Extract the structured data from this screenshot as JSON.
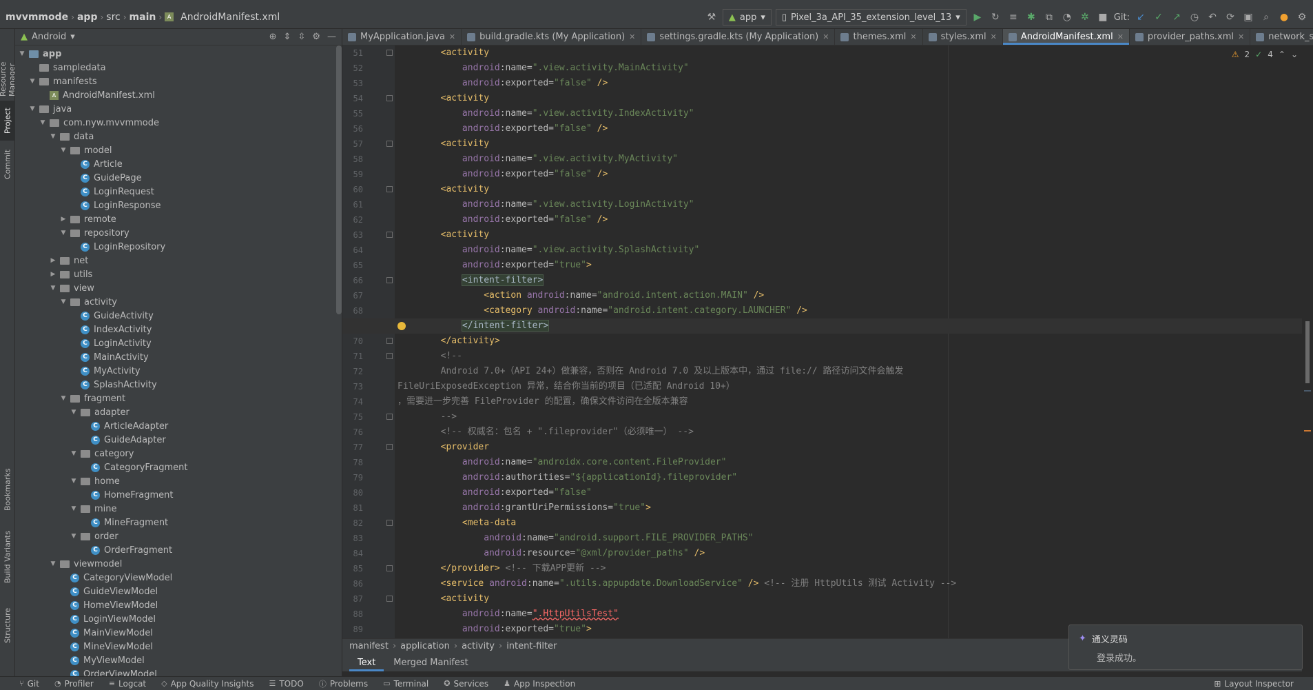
{
  "navbar": {
    "project": "mvvmmode",
    "module": "app",
    "src": "src",
    "main": "main",
    "file": "AndroidManifest.xml",
    "run_config": "app",
    "device": "Pixel_3a_API_35_extension_level_13",
    "git_label": "Git:"
  },
  "left_tools": [
    "Resource Manager",
    "Project",
    "Commit",
    "Bookmarks",
    "Build Variants",
    "Structure"
  ],
  "project_panel": {
    "view": "Android",
    "tree": [
      {
        "label": "app",
        "kind": "module",
        "depth": 0,
        "open": true,
        "bold": true
      },
      {
        "label": "sampledata",
        "kind": "folder",
        "depth": 1,
        "open": null
      },
      {
        "label": "manifests",
        "kind": "folder",
        "depth": 1,
        "open": true
      },
      {
        "label": "AndroidManifest.xml",
        "kind": "xml",
        "depth": 2,
        "open": null
      },
      {
        "label": "java",
        "kind": "folder",
        "depth": 1,
        "open": true
      },
      {
        "label": "com.nyw.mvvmmode",
        "kind": "folder",
        "depth": 2,
        "open": true
      },
      {
        "label": "data",
        "kind": "folder",
        "depth": 3,
        "open": true
      },
      {
        "label": "model",
        "kind": "folder",
        "depth": 4,
        "open": true
      },
      {
        "label": "Article",
        "kind": "class",
        "depth": 5,
        "open": null
      },
      {
        "label": "GuidePage",
        "kind": "class",
        "depth": 5,
        "open": null
      },
      {
        "label": "LoginRequest",
        "kind": "class",
        "depth": 5,
        "open": null
      },
      {
        "label": "LoginResponse",
        "kind": "class",
        "depth": 5,
        "open": null
      },
      {
        "label": "remote",
        "kind": "folder",
        "depth": 4,
        "open": false
      },
      {
        "label": "repository",
        "kind": "folder",
        "depth": 4,
        "open": true
      },
      {
        "label": "LoginRepository",
        "kind": "class",
        "depth": 5,
        "open": null
      },
      {
        "label": "net",
        "kind": "folder",
        "depth": 3,
        "open": false
      },
      {
        "label": "utils",
        "kind": "folder",
        "depth": 3,
        "open": false
      },
      {
        "label": "view",
        "kind": "folder",
        "depth": 3,
        "open": true
      },
      {
        "label": "activity",
        "kind": "folder",
        "depth": 4,
        "open": true
      },
      {
        "label": "GuideActivity",
        "kind": "class",
        "depth": 5,
        "open": null
      },
      {
        "label": "IndexActivity",
        "kind": "class",
        "depth": 5,
        "open": null
      },
      {
        "label": "LoginActivity",
        "kind": "class",
        "depth": 5,
        "open": null
      },
      {
        "label": "MainActivity",
        "kind": "class",
        "depth": 5,
        "open": null
      },
      {
        "label": "MyActivity",
        "kind": "class",
        "depth": 5,
        "open": null
      },
      {
        "label": "SplashActivity",
        "kind": "class",
        "depth": 5,
        "open": null
      },
      {
        "label": "fragment",
        "kind": "folder",
        "depth": 4,
        "open": true
      },
      {
        "label": "adapter",
        "kind": "folder",
        "depth": 5,
        "open": true
      },
      {
        "label": "ArticleAdapter",
        "kind": "class",
        "depth": 6,
        "open": null
      },
      {
        "label": "GuideAdapter",
        "kind": "class",
        "depth": 6,
        "open": null
      },
      {
        "label": "category",
        "kind": "folder",
        "depth": 5,
        "open": true
      },
      {
        "label": "CategoryFragment",
        "kind": "class",
        "depth": 6,
        "open": null
      },
      {
        "label": "home",
        "kind": "folder",
        "depth": 5,
        "open": true
      },
      {
        "label": "HomeFragment",
        "kind": "class",
        "depth": 6,
        "open": null
      },
      {
        "label": "mine",
        "kind": "folder",
        "depth": 5,
        "open": true
      },
      {
        "label": "MineFragment",
        "kind": "class",
        "depth": 6,
        "open": null
      },
      {
        "label": "order",
        "kind": "folder",
        "depth": 5,
        "open": true
      },
      {
        "label": "OrderFragment",
        "kind": "class",
        "depth": 6,
        "open": null
      },
      {
        "label": "viewmodel",
        "kind": "folder",
        "depth": 3,
        "open": true
      },
      {
        "label": "CategoryViewModel",
        "kind": "class",
        "depth": 4,
        "open": null
      },
      {
        "label": "GuideViewModel",
        "kind": "class",
        "depth": 4,
        "open": null
      },
      {
        "label": "HomeViewModel",
        "kind": "class",
        "depth": 4,
        "open": null
      },
      {
        "label": "LoginViewModel",
        "kind": "class",
        "depth": 4,
        "open": null
      },
      {
        "label": "MainViewModel",
        "kind": "class",
        "depth": 4,
        "open": null
      },
      {
        "label": "MineViewModel",
        "kind": "class",
        "depth": 4,
        "open": null
      },
      {
        "label": "MyViewModel",
        "kind": "class",
        "depth": 4,
        "open": null
      },
      {
        "label": "OrderViewModel",
        "kind": "class",
        "depth": 4,
        "open": null
      }
    ]
  },
  "tabs": [
    {
      "label": "MyApplication.java",
      "active": false
    },
    {
      "label": "build.gradle.kts (My Application)",
      "active": false
    },
    {
      "label": "settings.gradle.kts (My Application)",
      "active": false
    },
    {
      "label": "themes.xml",
      "active": false
    },
    {
      "label": "styles.xml",
      "active": false
    },
    {
      "label": "AndroidManifest.xml",
      "active": true
    },
    {
      "label": "provider_paths.xml",
      "active": false
    },
    {
      "label": "network_security_c",
      "active": false
    }
  ],
  "inspections": {
    "warnings": "2",
    "ok": "4"
  },
  "editor": {
    "current_line": 69,
    "lines": [
      {
        "n": 51,
        "indent": 2,
        "parts": [
          [
            "t",
            "<activity"
          ]
        ]
      },
      {
        "n": 52,
        "indent": 3,
        "parts": [
          [
            "a",
            "android"
          ],
          [
            "an",
            ":name="
          ],
          [
            "s",
            "\".view.activity.MainActivity\""
          ]
        ]
      },
      {
        "n": 53,
        "indent": 3,
        "parts": [
          [
            "a",
            "android"
          ],
          [
            "an",
            ":exported="
          ],
          [
            "s",
            "\"false\""
          ],
          [
            "t",
            " />"
          ]
        ]
      },
      {
        "n": 54,
        "indent": 2,
        "parts": [
          [
            "t",
            "<activity"
          ]
        ]
      },
      {
        "n": 55,
        "indent": 3,
        "parts": [
          [
            "a",
            "android"
          ],
          [
            "an",
            ":name="
          ],
          [
            "s",
            "\".view.activity.IndexActivity\""
          ]
        ]
      },
      {
        "n": 56,
        "indent": 3,
        "parts": [
          [
            "a",
            "android"
          ],
          [
            "an",
            ":exported="
          ],
          [
            "s",
            "\"false\""
          ],
          [
            "t",
            " />"
          ]
        ]
      },
      {
        "n": 57,
        "indent": 2,
        "parts": [
          [
            "t",
            "<activity"
          ]
        ]
      },
      {
        "n": 58,
        "indent": 3,
        "parts": [
          [
            "a",
            "android"
          ],
          [
            "an",
            ":name="
          ],
          [
            "s",
            "\".view.activity.MyActivity\""
          ]
        ]
      },
      {
        "n": 59,
        "indent": 3,
        "parts": [
          [
            "a",
            "android"
          ],
          [
            "an",
            ":exported="
          ],
          [
            "s",
            "\"false\""
          ],
          [
            "t",
            " />"
          ]
        ]
      },
      {
        "n": 60,
        "indent": 2,
        "parts": [
          [
            "t",
            "<activity"
          ]
        ]
      },
      {
        "n": 61,
        "indent": 3,
        "parts": [
          [
            "a",
            "android"
          ],
          [
            "an",
            ":name="
          ],
          [
            "s",
            "\".view.activity.LoginActivity\""
          ]
        ]
      },
      {
        "n": 62,
        "indent": 3,
        "parts": [
          [
            "a",
            "android"
          ],
          [
            "an",
            ":exported="
          ],
          [
            "s",
            "\"false\""
          ],
          [
            "t",
            " />"
          ]
        ]
      },
      {
        "n": 63,
        "indent": 2,
        "parts": [
          [
            "t",
            "<activity"
          ]
        ]
      },
      {
        "n": 64,
        "indent": 3,
        "parts": [
          [
            "a",
            "android"
          ],
          [
            "an",
            ":name="
          ],
          [
            "s",
            "\".view.activity.SplashActivity\""
          ]
        ]
      },
      {
        "n": 65,
        "indent": 3,
        "parts": [
          [
            "a",
            "android"
          ],
          [
            "an",
            ":exported="
          ],
          [
            "s",
            "\"true\""
          ],
          [
            "t",
            ">"
          ]
        ]
      },
      {
        "n": 66,
        "indent": 3,
        "parts": [
          [
            "hl",
            "<intent-filter>"
          ]
        ]
      },
      {
        "n": 67,
        "indent": 4,
        "parts": [
          [
            "t",
            "<action "
          ],
          [
            "a",
            "android"
          ],
          [
            "an",
            ":name="
          ],
          [
            "s",
            "\"android.intent.action.MAIN\""
          ],
          [
            "t",
            " />"
          ]
        ]
      },
      {
        "n": 68,
        "indent": 4,
        "parts": [
          [
            "t",
            "<category "
          ],
          [
            "a",
            "android"
          ],
          [
            "an",
            ":name="
          ],
          [
            "s",
            "\"android.intent.category.LAUNCHER\""
          ],
          [
            "t",
            " />"
          ]
        ]
      },
      {
        "n": 69,
        "indent": 3,
        "parts": [
          [
            "hl",
            "</intent-filter>"
          ]
        ]
      },
      {
        "n": 70,
        "indent": 2,
        "parts": [
          [
            "t",
            "</activity>"
          ]
        ]
      },
      {
        "n": 71,
        "indent": 2,
        "parts": [
          [
            "cm",
            "<!--"
          ]
        ]
      },
      {
        "n": 72,
        "indent": 2,
        "parts": [
          [
            "cm",
            "Android 7.0+（API 24+）做兼容，否则在 Android 7.0 及以上版本中，通过 file:// 路径访问文件会触发"
          ]
        ]
      },
      {
        "n": 73,
        "indent": 0,
        "parts": [
          [
            "cm",
            "FileUriExposedException 异常，结合你当前的项目（已适配 Android 10+）"
          ]
        ]
      },
      {
        "n": 74,
        "indent": 0,
        "parts": [
          [
            "cm",
            "，需要进一步完善 FileProvider 的配置，确保文件访问在全版本兼容"
          ]
        ]
      },
      {
        "n": 75,
        "indent": 2,
        "parts": [
          [
            "cm",
            "-->"
          ]
        ]
      },
      {
        "n": 76,
        "indent": 2,
        "parts": [
          [
            "cm",
            "<!-- 权威名：包名 + \".fileprovider\"（必须唯一） -->"
          ]
        ]
      },
      {
        "n": 77,
        "indent": 2,
        "parts": [
          [
            "t",
            "<provider"
          ]
        ]
      },
      {
        "n": 78,
        "indent": 3,
        "parts": [
          [
            "a",
            "android"
          ],
          [
            "an",
            ":name="
          ],
          [
            "s",
            "\"androidx.core.content.FileProvider\""
          ]
        ]
      },
      {
        "n": 79,
        "indent": 3,
        "parts": [
          [
            "a",
            "android"
          ],
          [
            "an",
            ":authorities="
          ],
          [
            "s",
            "\"${applicationId}.fileprovider\""
          ]
        ]
      },
      {
        "n": 80,
        "indent": 3,
        "parts": [
          [
            "a",
            "android"
          ],
          [
            "an",
            ":exported="
          ],
          [
            "s",
            "\"false\""
          ]
        ]
      },
      {
        "n": 81,
        "indent": 3,
        "parts": [
          [
            "a",
            "android"
          ],
          [
            "an",
            ":grantUriPermissions="
          ],
          [
            "s",
            "\"true\""
          ],
          [
            "t",
            ">"
          ]
        ]
      },
      {
        "n": 82,
        "indent": 3,
        "parts": [
          [
            "t",
            "<meta-data"
          ]
        ]
      },
      {
        "n": 83,
        "indent": 4,
        "parts": [
          [
            "a",
            "android"
          ],
          [
            "an",
            ":name="
          ],
          [
            "s",
            "\"android.support.FILE_PROVIDER_PATHS\""
          ]
        ]
      },
      {
        "n": 84,
        "indent": 4,
        "parts": [
          [
            "a",
            "android"
          ],
          [
            "an",
            ":resource="
          ],
          [
            "s",
            "\"@xml/provider_paths\""
          ],
          [
            "t",
            " />"
          ]
        ]
      },
      {
        "n": 85,
        "indent": 2,
        "parts": [
          [
            "t",
            "</provider>"
          ],
          [
            "cm",
            " <!-- 下载APP更新 -->"
          ]
        ]
      },
      {
        "n": 86,
        "indent": 2,
        "parts": [
          [
            "t",
            "<service "
          ],
          [
            "a",
            "android"
          ],
          [
            "an",
            ":name="
          ],
          [
            "s",
            "\".utils.appupdate.DownloadService\""
          ],
          [
            "t",
            " />"
          ],
          [
            "cm",
            " <!-- 注册 HttpUtils 测试 Activity -->"
          ]
        ]
      },
      {
        "n": 87,
        "indent": 2,
        "parts": [
          [
            "t",
            "<activity"
          ]
        ]
      },
      {
        "n": 88,
        "indent": 3,
        "parts": [
          [
            "a",
            "android"
          ],
          [
            "an",
            ":name="
          ],
          [
            "err",
            "\".HttpUtilsTest\""
          ]
        ]
      },
      {
        "n": 89,
        "indent": 3,
        "parts": [
          [
            "a",
            "android"
          ],
          [
            "an",
            ":exported="
          ],
          [
            "s",
            "\"true\""
          ],
          [
            "t",
            ">"
          ]
        ]
      }
    ]
  },
  "code_breadcrumb": [
    "manifest",
    "application",
    "activity",
    "intent-filter"
  ],
  "mode_tabs": [
    {
      "label": "Text",
      "active": true
    },
    {
      "label": "Merged Manifest",
      "active": false
    }
  ],
  "toast": {
    "title": "通义灵码",
    "message": "登录成功。"
  },
  "bottom_tools": [
    "Git",
    "Profiler",
    "Logcat",
    "App Quality Insights",
    "TODO",
    "Problems",
    "Terminal",
    "Services",
    "App Inspection"
  ],
  "layout_inspector": "Layout Inspector",
  "colors": {
    "accent": "#4a88c7",
    "tag": "#e8bf6a",
    "attr": "#9876aa",
    "string": "#6a8759",
    "comment": "#808080",
    "error": "#ff6b68"
  }
}
